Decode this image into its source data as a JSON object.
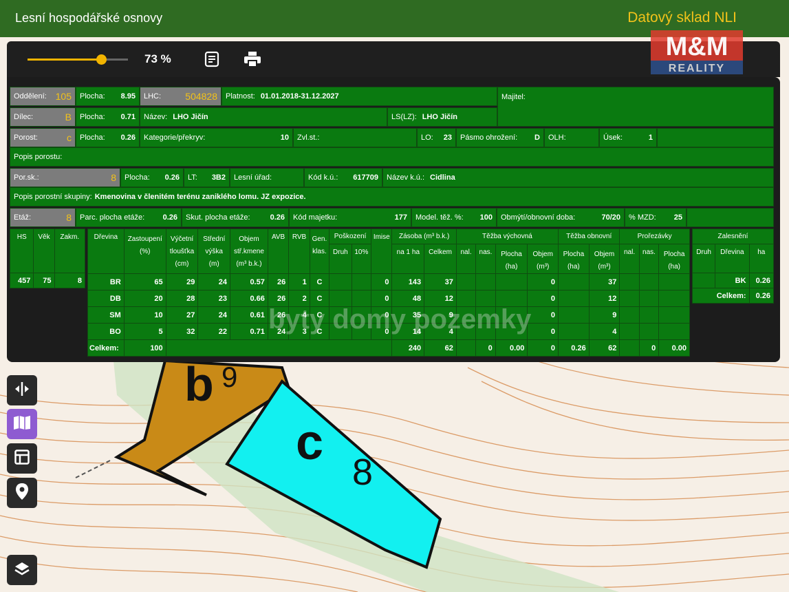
{
  "app": {
    "title": "Lesní hospodářské osnovy",
    "brand": "Datový sklad NLI"
  },
  "watermark": {
    "logo_text": "M&M REALITY",
    "overlay_text": "byty domy pozemky"
  },
  "toolbar": {
    "zoom_value": 73,
    "zoom_label": "73 %"
  },
  "map": {
    "stand_code": "c",
    "stand_class": "8",
    "neighbor_code": "b",
    "neighbor_class": "9"
  },
  "info": {
    "oddeleni": {
      "label": "Oddělení:",
      "value": "105"
    },
    "plocha1": {
      "label": "Plocha:",
      "value": "8.95"
    },
    "lhc": {
      "label": "LHC:",
      "value": "504828"
    },
    "platnost": {
      "label": "Platnost:",
      "value": "01.01.2018-31.12.2027"
    },
    "majitel": {
      "label": "Majitel:",
      "value": ""
    },
    "dilec": {
      "label": "Dílec:",
      "value": "B"
    },
    "plocha2": {
      "label": "Plocha:",
      "value": "0.71"
    },
    "nazev": {
      "label": "Název:",
      "value": "LHO Jičín"
    },
    "ls": {
      "label": "LS(LZ):",
      "value": "LHO Jičín"
    },
    "porost": {
      "label": "Porost:",
      "value": "c"
    },
    "plocha3": {
      "label": "Plocha:",
      "value": "0.26"
    },
    "kategorie": {
      "label": "Kategorie/překryv:",
      "value": "10"
    },
    "zvlst": {
      "label": "Zvl.st.:",
      "value": ""
    },
    "lo": {
      "label": "LO:",
      "value": "23"
    },
    "pasmo": {
      "label": "Pásmo ohrožení:",
      "value": "D"
    },
    "olh": {
      "label": "OLH:",
      "value": ""
    },
    "usek": {
      "label": "Úsek:",
      "value": "1"
    },
    "popis_porostu": {
      "label": "Popis porostu:",
      "value": ""
    },
    "porsk": {
      "label": "Por.sk.:",
      "value": "8"
    },
    "plocha4": {
      "label": "Plocha:",
      "value": "0.26"
    },
    "lt": {
      "label": "LT:",
      "value": "3B2"
    },
    "lesni_urad": {
      "label": "Lesní úřad:",
      "value": ""
    },
    "kod_ku": {
      "label": "Kód k.ú.:",
      "value": "617709"
    },
    "nazev_ku": {
      "label": "Název k.ú.:",
      "value": "Cidlina"
    },
    "popis_skupiny": {
      "label": "Popis porostní skupiny:",
      "value": "Kmenovina v členitém terénu zaniklého lomu. JZ expozice."
    },
    "etaz": {
      "label": "Etáž:",
      "value": "8"
    },
    "parc_plocha": {
      "label": "Parc. plocha etáže:",
      "value": "0.26"
    },
    "skut_plocha": {
      "label": "Skut. plocha etáže:",
      "value": "0.26"
    },
    "kod_majetku": {
      "label": "Kód majetku:",
      "value": "177"
    },
    "model_tez": {
      "label": "Model. těž. %:",
      "value": "100"
    },
    "obmyti": {
      "label": "Obmýtí/obnovní doba:",
      "value": "70/20"
    },
    "mzd": {
      "label": "% MZD:",
      "value": "25"
    }
  },
  "left_table": {
    "headers": [
      "HS",
      "Věk",
      "Zakm."
    ],
    "values": [
      "457",
      "75",
      "8"
    ]
  },
  "species_table": {
    "headers": {
      "drevina": "Dřevina",
      "zastoupeni": "Zastoupení (%)",
      "vycetni": "Výčetní tloušťka (cm)",
      "stredni": "Střední výška (m)",
      "objem": "Objem stř.kmene (m³ b.k.)",
      "avb": "AVB",
      "rvb": "RVB",
      "gen": "Gen. klas.",
      "poskozeni": "Poškození",
      "druh": "Druh",
      "p10": "10%",
      "imise": "Imise",
      "zasoba": "Zásoba (m³ b.k.)",
      "na1ha": "na 1 ha",
      "celkem": "Celkem",
      "tezba_vych": "Těžba výchovná",
      "nal": "nal.",
      "nas": "nas.",
      "plocha_ha": "Plocha (ha)",
      "objem_m3": "Objem (m³)",
      "tezba_obn": "Těžba obnovní",
      "prorezavky": "Prořezávky"
    },
    "rows": [
      [
        "BR",
        "65",
        "29",
        "24",
        "0.57",
        "26",
        "1",
        "C",
        "",
        "",
        "0",
        "143",
        "37",
        "",
        "",
        "",
        "0",
        "",
        "37",
        "",
        "",
        ""
      ],
      [
        "DB",
        "20",
        "28",
        "23",
        "0.66",
        "26",
        "2",
        "C",
        "",
        "",
        "0",
        "48",
        "12",
        "",
        "",
        "",
        "0",
        "",
        "12",
        "",
        "",
        ""
      ],
      [
        "SM",
        "10",
        "27",
        "24",
        "0.61",
        "26",
        "4",
        "C",
        "",
        "",
        "0",
        "35",
        "9",
        "",
        "",
        "",
        "0",
        "",
        "9",
        "",
        "",
        ""
      ],
      [
        "BO",
        "5",
        "32",
        "22",
        "0.71",
        "24",
        "3",
        "C",
        "",
        "",
        "0",
        "14",
        "4",
        "",
        "",
        "",
        "0",
        "",
        "4",
        "",
        "",
        ""
      ]
    ],
    "total_row": [
      "Celkem:",
      "100",
      "240",
      "62",
      "",
      "0",
      "0.00",
      "0",
      "0.26",
      "62",
      "",
      "0",
      "0.00"
    ]
  },
  "zalesneni": {
    "title": "Zalesnění",
    "headers": [
      "Druh",
      "Dřevina",
      "ha"
    ],
    "row": [
      "",
      "BK",
      "0.26"
    ],
    "total_label": "Celkem:",
    "total_value": "0.26"
  }
}
